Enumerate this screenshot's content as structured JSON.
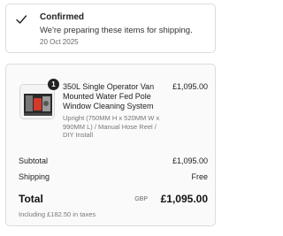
{
  "confirmation": {
    "title": "Confirmed",
    "message": "We're preparing these items for shipping.",
    "date": "20 Oct 2025",
    "icon": "check-icon"
  },
  "order": {
    "item": {
      "quantity": "1",
      "title": "350L Single Operator Van Mounted Water Fed Pole Window Cleaning System",
      "variant": "Upright (750MM H x 520MM W x 990MM L) / Manual Hose Reel / DIY Install",
      "price": "£1,095.00",
      "thumbnail": "product-thumbnail"
    },
    "subtotal": {
      "label": "Subtotal",
      "value": "£1,095.00"
    },
    "shipping": {
      "label": "Shipping",
      "value": "Free"
    },
    "total": {
      "label": "Total",
      "currency": "GBP",
      "value": "£1,095.00"
    },
    "taxes_note": "Including £182.50 in taxes"
  },
  "colors": {
    "border": "#dcdcdc",
    "badge": "#222222",
    "muted_text": "#777777",
    "card_background": "#fafafa"
  }
}
